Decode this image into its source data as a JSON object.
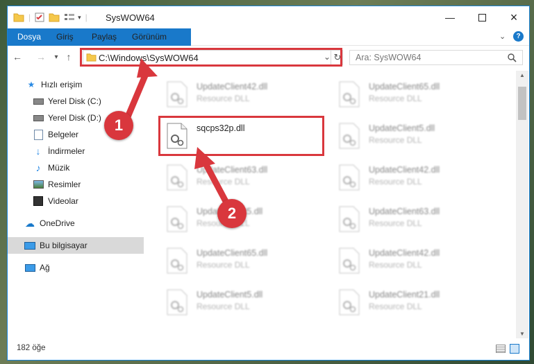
{
  "window": {
    "title": "SysWOW64"
  },
  "ribbon": {
    "tabs": [
      "Dosya",
      "Giriş",
      "Paylaş",
      "Görünüm"
    ]
  },
  "address": {
    "path": "C:\\Windows\\SysWOW64",
    "search_placeholder": "Ara: SysWOW64"
  },
  "sidebar": {
    "items": [
      {
        "label": "Hızlı erişim",
        "icon": "star-icon"
      },
      {
        "label": "Yerel Disk (C:)",
        "icon": "drive-icon",
        "pinned": true
      },
      {
        "label": "Yerel Disk (D:)",
        "icon": "drive-icon",
        "pinned": true
      },
      {
        "label": "Belgeler",
        "icon": "documents-icon",
        "pinned": true
      },
      {
        "label": "İndirmeler",
        "icon": "download-icon",
        "pinned": true
      },
      {
        "label": "Müzik",
        "icon": "music-icon",
        "pinned": true
      },
      {
        "label": "Resimler",
        "icon": "pictures-icon",
        "pinned": true
      },
      {
        "label": "Videolar",
        "icon": "videos-icon",
        "pinned": true
      },
      {
        "label": "OneDrive",
        "icon": "cloud-icon"
      },
      {
        "label": "Bu bilgisayar",
        "icon": "computer-icon",
        "selected": true
      },
      {
        "label": "Ağ",
        "icon": "network-icon"
      }
    ]
  },
  "files": [
    {
      "name": "UpdateClient42.dll",
      "type": "Resource DLL",
      "faded": true
    },
    {
      "name": "UpdateClient65.dll",
      "type": "Resource DLL",
      "faded": true
    },
    {
      "name": "sqcps32p.dll",
      "type": "",
      "faded": false
    },
    {
      "name": "UpdateClient5.dll",
      "type": "Resource DLL",
      "faded": true
    },
    {
      "name": "UpdateClient63.dll",
      "type": "Resource DLL",
      "faded": true
    },
    {
      "name": "UpdateClient42.dll",
      "type": "Resource DLL",
      "faded": true
    },
    {
      "name": "UpdateClient5.dll",
      "type": "Resource DLL",
      "faded": true
    },
    {
      "name": "UpdateClient63.dll",
      "type": "Resource DLL",
      "faded": true
    },
    {
      "name": "UpdateClient65.dll",
      "type": "Resource DLL",
      "faded": true
    },
    {
      "name": "UpdateClient42.dll",
      "type": "Resource DLL",
      "faded": true
    },
    {
      "name": "UpdateClient5.dll",
      "type": "Resource DLL",
      "faded": true
    },
    {
      "name": "UpdateClient21.dll",
      "type": "Resource DLL",
      "faded": true
    }
  ],
  "status": {
    "count": "182 öğe"
  },
  "annotations": {
    "step1": "1",
    "step2": "2",
    "color": "#d9373d"
  }
}
